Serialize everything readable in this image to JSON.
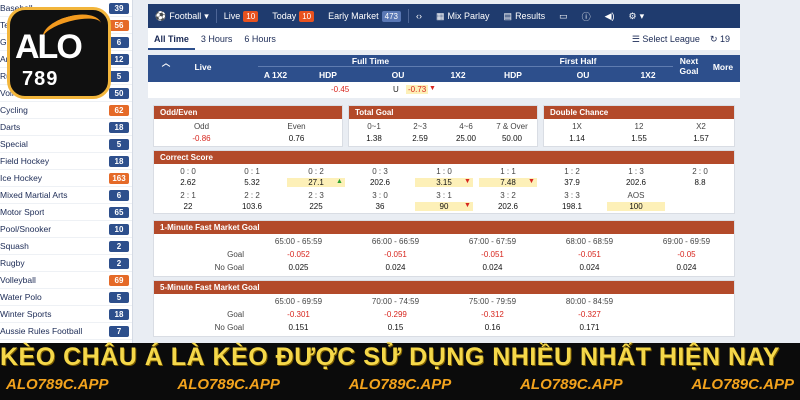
{
  "sidebar": {
    "items": [
      {
        "name": "Baseball",
        "count": "39",
        "hot": false
      },
      {
        "name": "Tennis",
        "count": "56",
        "hot": true
      },
      {
        "name": "Golf",
        "count": "6",
        "hot": false
      },
      {
        "name": "American Football",
        "count": "12",
        "hot": false
      },
      {
        "name": "Rugby League",
        "count": "5",
        "hot": false
      },
      {
        "name": "Volleyball",
        "count": "50",
        "hot": false
      },
      {
        "name": "Cycling",
        "count": "62",
        "hot": true
      },
      {
        "name": "Darts",
        "count": "18",
        "hot": false
      },
      {
        "name": "Special",
        "count": "5",
        "hot": false
      },
      {
        "name": "Field Hockey",
        "count": "18",
        "hot": false
      },
      {
        "name": "Ice Hockey",
        "count": "163",
        "hot": true
      },
      {
        "name": "Mixed Martial Arts",
        "count": "6",
        "hot": false
      },
      {
        "name": "Motor Sport",
        "count": "65",
        "hot": false
      },
      {
        "name": "Pool/Snooker",
        "count": "10",
        "hot": false
      },
      {
        "name": "Squash",
        "count": "2",
        "hot": false
      },
      {
        "name": "Rugby",
        "count": "2",
        "hot": false
      },
      {
        "name": "Volleyball",
        "count": "69",
        "hot": true
      },
      {
        "name": "Water Polo",
        "count": "5",
        "hot": false
      },
      {
        "name": "Winter Sports",
        "count": "18",
        "hot": false
      },
      {
        "name": "Aussie Rules Football",
        "count": "7",
        "hot": false
      }
    ]
  },
  "logo": {
    "alo": "ALO",
    "num": "789"
  },
  "topnav": {
    "sport": "Football",
    "live_label": "Live",
    "live_count": "10",
    "today_label": "Today",
    "today_count": "10",
    "early_label": "Early Market",
    "early_count": "473",
    "mix_label": "Mix Parlay",
    "results_label": "Results"
  },
  "filter": {
    "tabs": [
      "All Time",
      "3 Hours",
      "6 Hours"
    ],
    "select_league": "Select League",
    "refresh_count": "19"
  },
  "thead": {
    "live": "Live",
    "full_time": "Full Time",
    "first_half": "First Half",
    "next_goal": "Next Goal",
    "more": "More",
    "cols": [
      "A 1X2",
      "HDP",
      "OU",
      "1X2",
      "HDP",
      "OU",
      "1X2"
    ]
  },
  "subrow": {
    "hdp": "-0.45",
    "ou_label": "U",
    "ou_val": "-0.73"
  },
  "odd_even": {
    "title": "Odd/Even",
    "labels": [
      "Odd",
      "Even"
    ],
    "values": [
      "-0.86",
      "0.76"
    ]
  },
  "total_goal": {
    "title": "Total Goal",
    "labels": [
      "0~1",
      "2~3",
      "4~6",
      "7 & Over"
    ],
    "values": [
      "1.38",
      "2.59",
      "25.00",
      "50.00"
    ]
  },
  "double_chance": {
    "title": "Double Chance",
    "labels": [
      "1X",
      "12",
      "X2"
    ],
    "values": [
      "1.14",
      "1.55",
      "1.57"
    ]
  },
  "correct_score": {
    "title": "Correct Score",
    "row1_labels": [
      "0 : 0",
      "0 : 1",
      "0 : 2",
      "0 : 3",
      "1 : 0",
      "1 : 1",
      "1 : 2",
      "1 : 3",
      "2 : 0"
    ],
    "row1_values": [
      "2.62",
      "5.32",
      "27.1",
      "202.6",
      "3.15",
      "7.48",
      "37.9",
      "202.6",
      "8.8"
    ],
    "row2_labels": [
      "2 : 1",
      "2 : 2",
      "2 : 3",
      "3 : 0",
      "3 : 1",
      "3 : 2",
      "3 : 3",
      "AOS"
    ],
    "row2_values": [
      "22",
      "103.6",
      "225",
      "36",
      "90",
      "202.6",
      "198.1",
      "100"
    ]
  },
  "fast1": {
    "title": "1-Minute Fast Market Goal",
    "ranges": [
      "65:00 - 65:59",
      "66:00 - 66:59",
      "67:00 - 67:59",
      "68:00 - 68:59",
      "69:00 - 69:59"
    ],
    "goal_label": "Goal",
    "nogoal_label": "No Goal",
    "goal": [
      "-0.052",
      "-0.051",
      "-0.051",
      "-0.051",
      "-0.05"
    ],
    "nogoal": [
      "0.025",
      "0.024",
      "0.024",
      "0.024",
      "0.024"
    ]
  },
  "fast5": {
    "title": "5-Minute Fast Market Goal",
    "ranges": [
      "65:00 - 69:59",
      "70:00 - 74:59",
      "75:00 - 79:59",
      "80:00 - 84:59"
    ],
    "goal_label": "Goal",
    "nogoal_label": "No Goal",
    "goal": [
      "-0.301",
      "-0.299",
      "-0.312",
      "-0.327"
    ],
    "nogoal": [
      "0.151",
      "0.15",
      "0.16",
      "0.171"
    ]
  },
  "banner": {
    "title": "KÈO CHÂU Á LÀ KÈO ĐƯỢC SỬ DỤNG NHIỀU NHẤT HIỆN NAY",
    "urls": [
      "ALO789C.APP",
      "ALO789C.APP",
      "ALO789C.APP",
      "ALO789C.APP",
      "ALO789C.APP"
    ]
  },
  "colors": {
    "nav": "#1f3b6e",
    "header": "#2d4f8c",
    "panel_title": "#b34a2a",
    "accent": "#e8521f",
    "banner_text": "#f5d84a",
    "url_text": "#f3a31d"
  }
}
